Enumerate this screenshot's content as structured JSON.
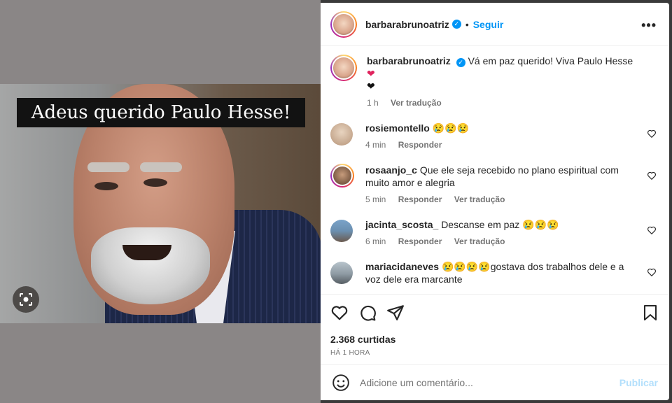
{
  "media": {
    "caption_text": "Adeus querido Paulo Hesse!"
  },
  "header": {
    "username": "barbarabrunoatriz",
    "separator": "•",
    "follow_label": "Seguir",
    "more_label": "•••"
  },
  "post": {
    "username": "barbarabrunoatriz",
    "text": "Vá em paz querido! Viva Paulo Hesse",
    "emojis": [
      "red-heart",
      "black-heart"
    ],
    "time": "1 h",
    "translate_label": "Ver tradução"
  },
  "comments": [
    {
      "username": "rosiemontello",
      "text": "😢😢😢",
      "time": "4 min",
      "reply_label": "Responder",
      "translate_label": ""
    },
    {
      "username": "rosaanjo_c",
      "text": "Que ele seja recebido no plano espiritual com muito amor e alegria",
      "time": "5 min",
      "reply_label": "Responder",
      "translate_label": "Ver tradução"
    },
    {
      "username": "jacinta_scosta_",
      "text": "Descanse em paz 😢😢😢",
      "time": "6 min",
      "reply_label": "Responder",
      "translate_label": "Ver tradução"
    },
    {
      "username": "mariacidaneves",
      "text": "😢😢😢😢gostava dos trabalhos dele e a voz dele era marcante",
      "time": "",
      "reply_label": "",
      "translate_label": ""
    }
  ],
  "actions": {
    "likes": "2.368 curtidas",
    "posted_time": "HÁ 1 HORA"
  },
  "add_comment": {
    "placeholder": "Adicione um comentário...",
    "publish_label": "Publicar"
  },
  "colors": {
    "accent": "#0095f6",
    "text": "#262626",
    "muted": "#737373",
    "publish_disabled": "#b2dffc"
  }
}
